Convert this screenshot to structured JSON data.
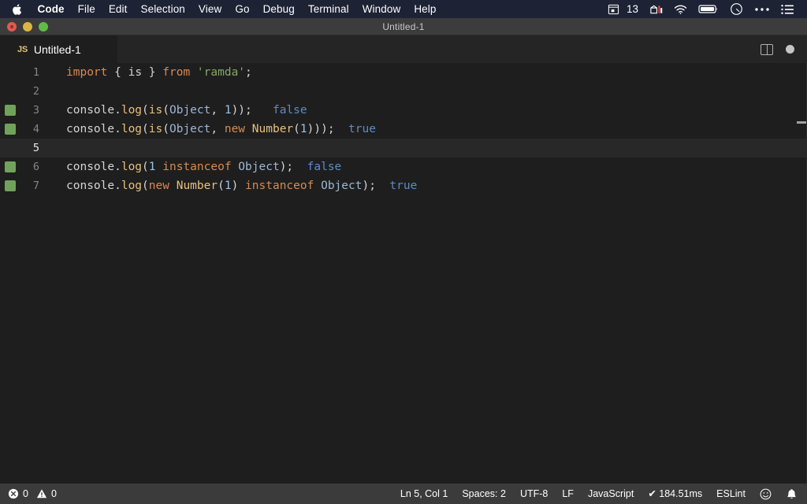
{
  "menubar": {
    "apple_icon": "apple-logo",
    "items": [
      {
        "label": "Code",
        "bold": true
      },
      {
        "label": "File",
        "bold": false
      },
      {
        "label": "Edit",
        "bold": false
      },
      {
        "label": "Selection",
        "bold": false
      },
      {
        "label": "View",
        "bold": false
      },
      {
        "label": "Go",
        "bold": false
      },
      {
        "label": "Debug",
        "bold": false
      },
      {
        "label": "Terminal",
        "bold": false
      },
      {
        "label": "Window",
        "bold": false
      },
      {
        "label": "Help",
        "bold": false
      }
    ],
    "tray": {
      "calendar_icon": "calendar-icon",
      "calendar_date": "13",
      "activity_icon": "activity-monitor-icon",
      "wifi_icon": "wifi-icon",
      "battery_icon": "battery-icon",
      "timer_icon": "timer-icon",
      "overflow_icon": "ellipsis-icon",
      "list_icon": "list-icon"
    },
    "background": "#1d2235"
  },
  "window": {
    "title": "Untitled-1",
    "controls": {
      "close": "close-window-button",
      "minimize": "minimize-window-button",
      "maximize": "maximize-window-button"
    }
  },
  "tabs": {
    "active": {
      "badge": "JS",
      "label": "Untitled-1"
    },
    "actions": {
      "split_editor": "split-editor-icon",
      "unsaved_indicator": "unsaved-dot"
    }
  },
  "editor": {
    "language": "JavaScript",
    "active_line": 5,
    "lines": [
      {
        "number": "1",
        "marker": false,
        "active": false,
        "tokens": [
          {
            "text": "import",
            "cls": "t-key"
          },
          {
            "text": " { ",
            "cls": "t-punc"
          },
          {
            "text": "is",
            "cls": "t-plain"
          },
          {
            "text": " } ",
            "cls": "t-punc"
          },
          {
            "text": "from",
            "cls": "t-key"
          },
          {
            "text": " ",
            "cls": "t-punc"
          },
          {
            "text": "'ramda'",
            "cls": "t-str"
          },
          {
            "text": ";",
            "cls": "t-punc"
          }
        ]
      },
      {
        "number": "2",
        "marker": false,
        "active": false,
        "tokens": []
      },
      {
        "number": "3",
        "marker": true,
        "active": false,
        "tokens": [
          {
            "text": "console",
            "cls": "t-plain"
          },
          {
            "text": ".",
            "cls": "t-punc"
          },
          {
            "text": "log",
            "cls": "t-fn"
          },
          {
            "text": "(",
            "cls": "t-punc"
          },
          {
            "text": "is",
            "cls": "t-fn"
          },
          {
            "text": "(",
            "cls": "t-punc"
          },
          {
            "text": "Object",
            "cls": "t-type"
          },
          {
            "text": ", ",
            "cls": "t-punc"
          },
          {
            "text": "1",
            "cls": "t-num"
          },
          {
            "text": "));",
            "cls": "t-punc"
          },
          {
            "text": "   ",
            "cls": "t-punc"
          },
          {
            "text": "false",
            "cls": "t-result"
          }
        ]
      },
      {
        "number": "4",
        "marker": true,
        "active": false,
        "tokens": [
          {
            "text": "console",
            "cls": "t-plain"
          },
          {
            "text": ".",
            "cls": "t-punc"
          },
          {
            "text": "log",
            "cls": "t-fn"
          },
          {
            "text": "(",
            "cls": "t-punc"
          },
          {
            "text": "is",
            "cls": "t-fn"
          },
          {
            "text": "(",
            "cls": "t-punc"
          },
          {
            "text": "Object",
            "cls": "t-type"
          },
          {
            "text": ", ",
            "cls": "t-punc"
          },
          {
            "text": "new",
            "cls": "t-key"
          },
          {
            "text": " ",
            "cls": "t-punc"
          },
          {
            "text": "Number",
            "cls": "t-fn"
          },
          {
            "text": "(",
            "cls": "t-punc"
          },
          {
            "text": "1",
            "cls": "t-num"
          },
          {
            "text": ")));",
            "cls": "t-punc"
          },
          {
            "text": "  ",
            "cls": "t-punc"
          },
          {
            "text": "true",
            "cls": "t-result"
          }
        ]
      },
      {
        "number": "5",
        "marker": false,
        "active": true,
        "tokens": []
      },
      {
        "number": "6",
        "marker": true,
        "active": false,
        "tokens": [
          {
            "text": "console",
            "cls": "t-plain"
          },
          {
            "text": ".",
            "cls": "t-punc"
          },
          {
            "text": "log",
            "cls": "t-fn"
          },
          {
            "text": "(",
            "cls": "t-punc"
          },
          {
            "text": "1",
            "cls": "t-num"
          },
          {
            "text": " ",
            "cls": "t-punc"
          },
          {
            "text": "instanceof",
            "cls": "t-key"
          },
          {
            "text": " ",
            "cls": "t-punc"
          },
          {
            "text": "Object",
            "cls": "t-type"
          },
          {
            "text": ");",
            "cls": "t-punc"
          },
          {
            "text": "  ",
            "cls": "t-punc"
          },
          {
            "text": "false",
            "cls": "t-result"
          }
        ]
      },
      {
        "number": "7",
        "marker": true,
        "active": false,
        "tokens": [
          {
            "text": "console",
            "cls": "t-plain"
          },
          {
            "text": ".",
            "cls": "t-punc"
          },
          {
            "text": "log",
            "cls": "t-fn"
          },
          {
            "text": "(",
            "cls": "t-punc"
          },
          {
            "text": "new",
            "cls": "t-key"
          },
          {
            "text": " ",
            "cls": "t-punc"
          },
          {
            "text": "Number",
            "cls": "t-fn"
          },
          {
            "text": "(",
            "cls": "t-punc"
          },
          {
            "text": "1",
            "cls": "t-num"
          },
          {
            "text": ") ",
            "cls": "t-punc"
          },
          {
            "text": "instanceof",
            "cls": "t-key"
          },
          {
            "text": " ",
            "cls": "t-punc"
          },
          {
            "text": "Object",
            "cls": "t-type"
          },
          {
            "text": ");",
            "cls": "t-punc"
          },
          {
            "text": "  ",
            "cls": "t-punc"
          },
          {
            "text": "true",
            "cls": "t-result"
          }
        ]
      }
    ],
    "colors": {
      "background": "#1e1e1e",
      "active_line": "#282828",
      "keyword": "#d98a52",
      "string": "#85a865",
      "function": "#e8c07d",
      "number": "#9cc4e4",
      "type": "#9cb7d6",
      "inline_result": "#5b8cc8",
      "gutter_marker": "#71a25a"
    }
  },
  "statusbar": {
    "errors_icon": "error-icon",
    "errors_count": "0",
    "warnings_icon": "warning-icon",
    "warnings_count": "0",
    "cursor_position": "Ln 5, Col 1",
    "indentation": "Spaces: 2",
    "encoding": "UTF-8",
    "eol": "LF",
    "language": "JavaScript",
    "runtime": "✔ 184.51ms",
    "linter": "ESLint",
    "feedback_icon": "smiley-icon",
    "notifications_icon": "bell-icon",
    "background": "#3b3b3b"
  }
}
